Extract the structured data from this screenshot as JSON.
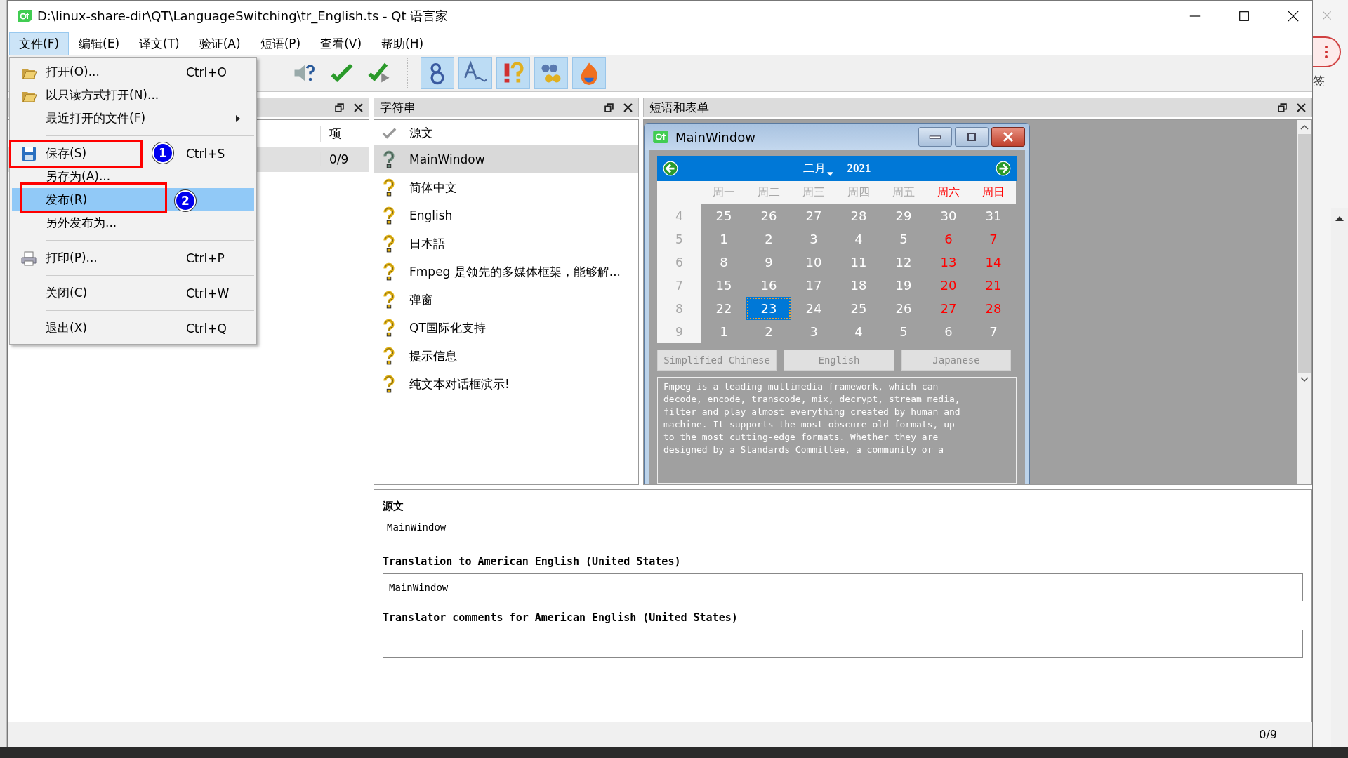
{
  "window": {
    "title": "D:\\linux-share-dir\\QT\\LanguageSwitching\\tr_English.ts - Qt 语言家"
  },
  "menubar": [
    {
      "label": "文件(F)",
      "selected": true
    },
    {
      "label": "编辑(E)",
      "selected": false
    },
    {
      "label": "译文(T)",
      "selected": false
    },
    {
      "label": "验证(A)",
      "selected": false
    },
    {
      "label": "短语(P)",
      "selected": false
    },
    {
      "label": "查看(V)",
      "selected": false
    },
    {
      "label": "帮助(H)",
      "selected": false
    }
  ],
  "file_menu": [
    {
      "kind": "item",
      "label": "打开(O)...",
      "shortcut": "Ctrl+O",
      "selected": false
    },
    {
      "kind": "item",
      "label": "以只读方式打开(N)...",
      "selected": false
    },
    {
      "kind": "submenu",
      "label": "最近打开的文件(F)",
      "selected": false
    },
    {
      "kind": "separator"
    },
    {
      "kind": "item",
      "label": "保存(S)",
      "shortcut": "Ctrl+S",
      "selected": false,
      "marker": "1"
    },
    {
      "kind": "item",
      "label": "另存为(A)...",
      "selected": false
    },
    {
      "kind": "item",
      "label": "发布(R)",
      "selected": true,
      "marker": "2"
    },
    {
      "kind": "item",
      "label": "另外发布为...",
      "selected": false
    },
    {
      "kind": "separator"
    },
    {
      "kind": "item",
      "label": "打印(P)...",
      "shortcut": "Ctrl+P",
      "selected": false
    },
    {
      "kind": "separator"
    },
    {
      "kind": "item",
      "label": "关闭(C)",
      "shortcut": "Ctrl+W",
      "selected": false
    },
    {
      "kind": "separator"
    },
    {
      "kind": "item",
      "label": "退出(X)",
      "shortcut": "Ctrl+Q",
      "selected": false
    }
  ],
  "toolbar": [
    {
      "checked": false
    },
    {
      "checked": false
    },
    {
      "checked": false
    },
    {
      "checked": true
    },
    {
      "checked": true
    },
    {
      "checked": true
    },
    {
      "checked": true
    },
    {
      "checked": true
    }
  ],
  "context_dock": {
    "column_header": "项",
    "rows": [
      {
        "items": "0/9",
        "selected": true
      }
    ]
  },
  "strings_dock": {
    "title": "字符串",
    "header": "源文",
    "rows": [
      {
        "text": "MainWindow",
        "selected": true
      },
      {
        "text": "简体中文",
        "selected": false
      },
      {
        "text": "English",
        "selected": false
      },
      {
        "text": "日本語",
        "selected": false
      },
      {
        "text": "Fmpeg 是领先的多媒体框架，能够解...",
        "selected": false
      },
      {
        "text": "弹窗",
        "selected": false
      },
      {
        "text": "QT国际化支持",
        "selected": false
      },
      {
        "text": "提示信息",
        "selected": false
      },
      {
        "text": "纯文本对话框演示!",
        "selected": false
      }
    ]
  },
  "phrases_dock": {
    "title": "短语和表单",
    "form": {
      "title": "MainWindow",
      "calendar": {
        "month": "二月",
        "year": "2021",
        "weekdays": [
          {
            "label": "周一",
            "weekend": false
          },
          {
            "label": "周二",
            "weekend": false
          },
          {
            "label": "周三",
            "weekend": false
          },
          {
            "label": "周四",
            "weekend": false
          },
          {
            "label": "周五",
            "weekend": false
          },
          {
            "label": "周六",
            "weekend": true
          },
          {
            "label": "周日",
            "weekend": true
          }
        ],
        "weeks": [
          {
            "number": "4",
            "days": [
              {
                "day": "25",
                "red": false,
                "selected": false
              },
              {
                "day": "26",
                "red": false,
                "selected": false
              },
              {
                "day": "27",
                "red": false,
                "selected": false
              },
              {
                "day": "28",
                "red": false,
                "selected": false
              },
              {
                "day": "29",
                "red": false,
                "selected": false
              },
              {
                "day": "30",
                "red": false,
                "selected": false
              },
              {
                "day": "31",
                "red": false,
                "selected": false
              }
            ]
          },
          {
            "number": "5",
            "days": [
              {
                "day": "1",
                "red": false,
                "selected": false
              },
              {
                "day": "2",
                "red": false,
                "selected": false
              },
              {
                "day": "3",
                "red": false,
                "selected": false
              },
              {
                "day": "4",
                "red": false,
                "selected": false
              },
              {
                "day": "5",
                "red": false,
                "selected": false
              },
              {
                "day": "6",
                "red": true,
                "selected": false
              },
              {
                "day": "7",
                "red": true,
                "selected": false
              }
            ]
          },
          {
            "number": "6",
            "days": [
              {
                "day": "8",
                "red": false,
                "selected": false
              },
              {
                "day": "9",
                "red": false,
                "selected": false
              },
              {
                "day": "10",
                "red": false,
                "selected": false
              },
              {
                "day": "11",
                "red": false,
                "selected": false
              },
              {
                "day": "12",
                "red": false,
                "selected": false
              },
              {
                "day": "13",
                "red": true,
                "selected": false
              },
              {
                "day": "14",
                "red": true,
                "selected": false
              }
            ]
          },
          {
            "number": "7",
            "days": [
              {
                "day": "15",
                "red": false,
                "selected": false
              },
              {
                "day": "16",
                "red": false,
                "selected": false
              },
              {
                "day": "17",
                "red": false,
                "selected": false
              },
              {
                "day": "18",
                "red": false,
                "selected": false
              },
              {
                "day": "19",
                "red": false,
                "selected": false
              },
              {
                "day": "20",
                "red": true,
                "selected": false
              },
              {
                "day": "21",
                "red": true,
                "selected": false
              }
            ]
          },
          {
            "number": "8",
            "days": [
              {
                "day": "22",
                "red": false,
                "selected": false
              },
              {
                "day": "23",
                "red": false,
                "selected": true
              },
              {
                "day": "24",
                "red": false,
                "selected": false
              },
              {
                "day": "25",
                "red": false,
                "selected": false
              },
              {
                "day": "26",
                "red": false,
                "selected": false
              },
              {
                "day": "27",
                "red": true,
                "selected": false
              },
              {
                "day": "28",
                "red": true,
                "selected": false
              }
            ]
          },
          {
            "number": "9",
            "days": [
              {
                "day": "1",
                "red": false,
                "selected": false
              },
              {
                "day": "2",
                "red": false,
                "selected": false
              },
              {
                "day": "3",
                "red": false,
                "selected": false
              },
              {
                "day": "4",
                "red": false,
                "selected": false
              },
              {
                "day": "5",
                "red": false,
                "selected": false
              },
              {
                "day": "6",
                "red": false,
                "selected": false
              },
              {
                "day": "7",
                "red": false,
                "selected": false
              }
            ]
          }
        ]
      },
      "buttons": [
        "Simplified Chinese",
        "English",
        "Japanese"
      ],
      "text_lines": [
        "Fmpeg is a leading multimedia framework, which can",
        "decode, encode, transcode, mix, decrypt, stream media,",
        "filter and play almost everything created by human and",
        "machine. It supports the most obscure old formats, up",
        "to the most cutting-edge formats. Whether they are",
        "designed by a Standards Committee, a community or a"
      ]
    }
  },
  "editor": {
    "source_label": "源文",
    "source_text": "MainWindow",
    "translation_label": "Translation to American English (United States)",
    "translation_value": "MainWindow",
    "comments_label": "Translator comments for American English (United States)"
  },
  "status_bar": {
    "progress": "0/9"
  },
  "background_app": {
    "label": "签"
  }
}
